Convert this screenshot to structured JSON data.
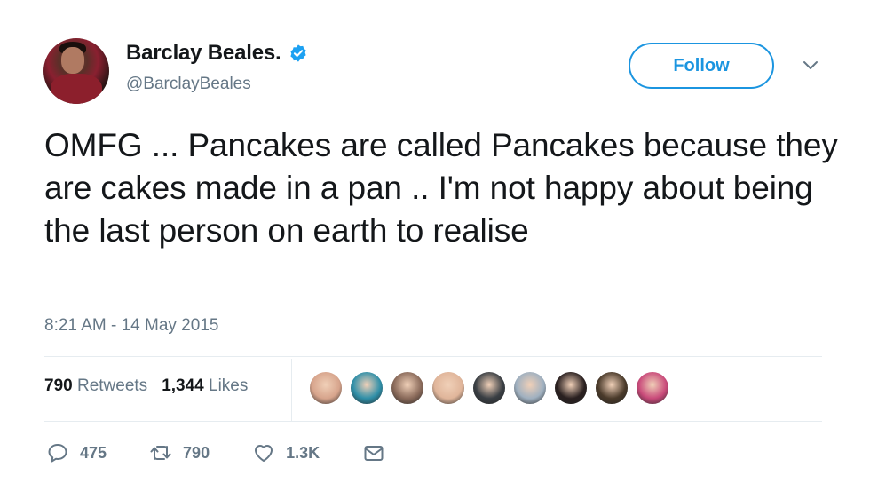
{
  "user": {
    "name": "Barclay Beales.",
    "handle": "@BarclayBeales",
    "verified": true
  },
  "follow_label": "Follow",
  "tweet": {
    "text": "OMFG ... Pancakes are called Pancakes because they are cakes made in a pan .. I'm not happy about being the last person on earth to realise",
    "timestamp": "8:21 AM - 14 May 2015"
  },
  "stats": {
    "retweets_count": "790",
    "retweets_label": "Retweets",
    "likes_count": "1,344",
    "likes_label": "Likes"
  },
  "liker_avatars": [
    "#d7a48c",
    "#2f8fa8",
    "#8a6a5a",
    "#e0b59a",
    "#3a3f44",
    "#9fb0c0",
    "#2a2020",
    "#4a3a2a",
    "#c94a7a"
  ],
  "actions": {
    "reply_count": "475",
    "retweet_count": "790",
    "like_count": "1.3K"
  },
  "colors": {
    "accent": "#1b95e0",
    "secondary_text": "#657786",
    "primary_text": "#14171a",
    "divider": "#e6ecf0"
  },
  "icons": [
    "verified-badge-icon",
    "chevron-down-icon",
    "reply-icon",
    "retweet-icon",
    "like-icon",
    "direct-message-icon"
  ]
}
